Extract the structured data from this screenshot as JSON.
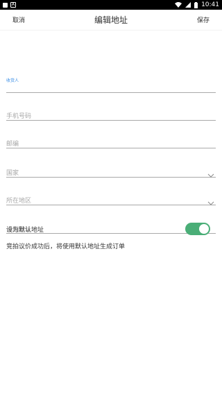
{
  "status_bar": {
    "time": "10:41",
    "icons": [
      "notification-square-icon",
      "a-box-icon",
      "wifi-icon",
      "signal-icon",
      "battery-icon"
    ]
  },
  "nav": {
    "cancel_label": "取消",
    "title": "编辑地址",
    "save_label": "保存"
  },
  "form": {
    "recipient": {
      "label": "收货人",
      "value": ""
    },
    "phone": {
      "placeholder": "手机号码",
      "value": ""
    },
    "postcode": {
      "placeholder": "邮编",
      "value": ""
    },
    "country": {
      "placeholder": "国家",
      "value": "",
      "icon": "chevron-down-icon"
    },
    "region": {
      "placeholder": "所在地区",
      "value": "",
      "icon": "chevron-down-icon"
    },
    "address": {
      "placeholder": "详细地址",
      "value": ""
    }
  },
  "default_address": {
    "label": "设为默认地址",
    "enabled": true
  },
  "note": "竞拍议价成功后，将使用默认地址生成订单",
  "colors": {
    "accent_blue": "#3a8ee6",
    "toggle_on": "#4aae77",
    "status_bar": "#000000"
  }
}
